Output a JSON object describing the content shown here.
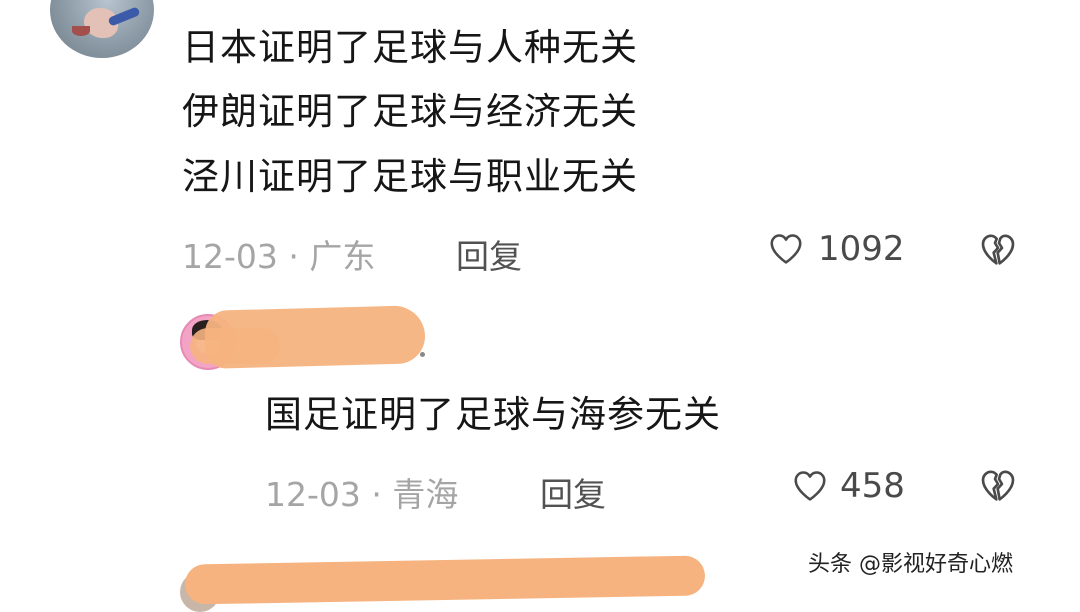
{
  "comments": [
    {
      "lines": [
        "日本证明了足球与人种无关",
        "伊朗证明了足球与经济无关",
        "泾川证明了足球与职业无关"
      ],
      "date_location": "12-03 · 广东",
      "reply_label": "回复",
      "likes": "1092"
    },
    {
      "text": "国足证明了足球与海参无关",
      "date_location": "12-03 · 青海",
      "reply_label": "回复",
      "likes": "458"
    }
  ],
  "watermark": "头条 @影视好奇心燃",
  "icons": {
    "like": "heart-outline-icon",
    "dislike": "broken-heart-icon"
  },
  "colors": {
    "text": "#161616",
    "meta": "#a5a5a5",
    "redaction": "#f6b37f"
  }
}
